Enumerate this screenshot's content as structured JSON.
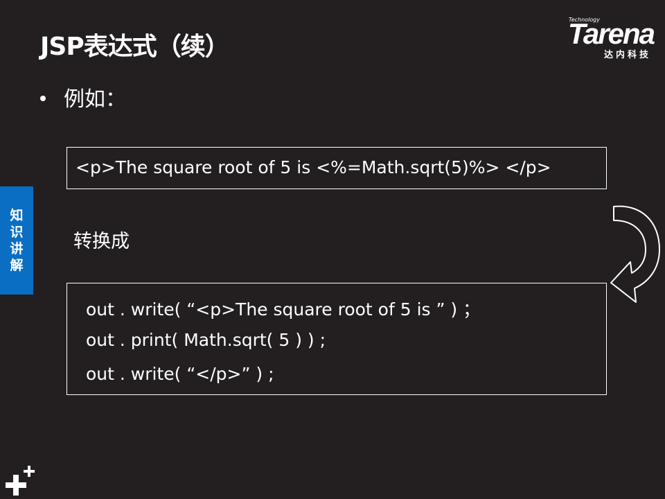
{
  "slide": {
    "title": "JSP表达式（续）",
    "bullet": "例如：",
    "code_box_1": "<p>The square root of 5 is <%=Math.sqrt(5)%> </p>",
    "convert_label": "转换成",
    "code_box_2": [
      "out . write( “<p>The square root of 5 is ”  ) ；",
      "out . print( Math.sqrt( 5 ) ) ;",
      "out . write( “</p>” ) ;"
    ],
    "side_tab": [
      "知",
      "识",
      "讲",
      "解"
    ]
  },
  "logo": {
    "tagline": "Technology",
    "brand": "Tarena",
    "chinese": "达内科技"
  },
  "icons": {
    "arrow": "curved-arrow-icon",
    "plus": "plus-icon"
  },
  "colors": {
    "background": "#231f20",
    "side_tab": "#0a6fc2",
    "text": "#ffffff"
  }
}
